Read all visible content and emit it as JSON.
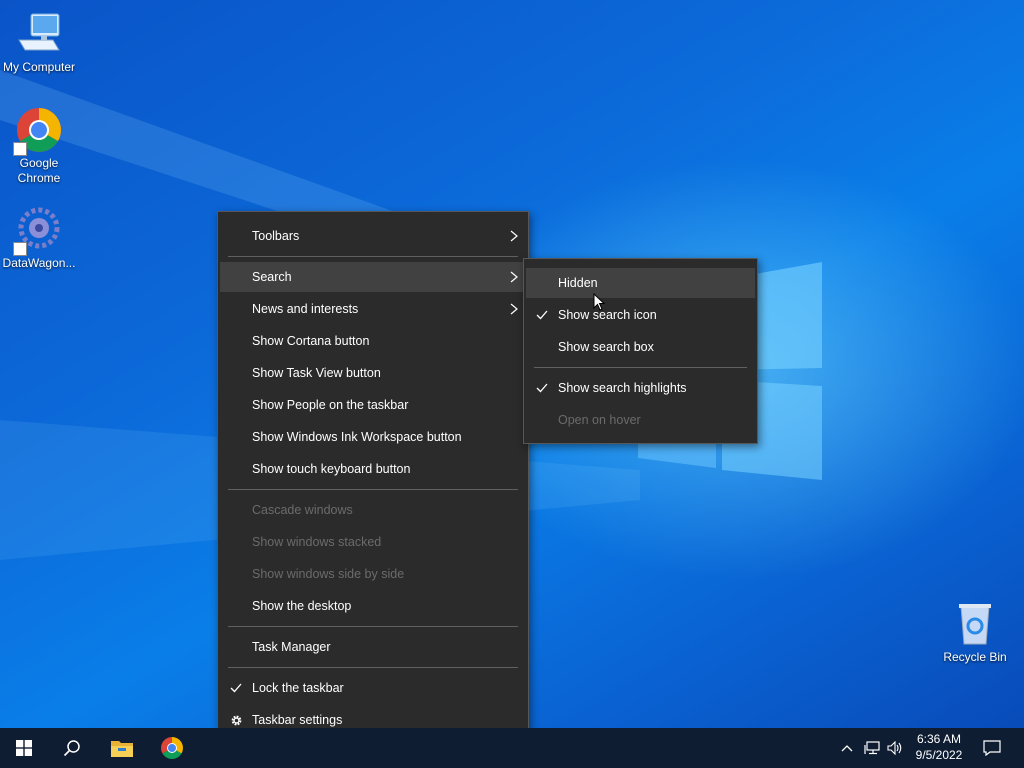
{
  "desktop": {
    "icons": [
      {
        "label": "My Computer",
        "icon": "computer-icon"
      },
      {
        "label": "Google Chrome",
        "icon": "chrome-icon"
      },
      {
        "label": "DataWagon...",
        "icon": "datawagon-icon"
      },
      {
        "label": "Recycle Bin",
        "icon": "recycle-bin-icon"
      }
    ]
  },
  "context_menu": {
    "items": [
      {
        "label": "Toolbars",
        "submenu": true
      },
      {
        "label": "Search",
        "submenu": true,
        "highlighted": true
      },
      {
        "label": "News and interests",
        "submenu": true
      },
      {
        "label": "Show Cortana button"
      },
      {
        "label": "Show Task View button"
      },
      {
        "label": "Show People on the taskbar"
      },
      {
        "label": "Show Windows Ink Workspace button"
      },
      {
        "label": "Show touch keyboard button"
      },
      {
        "label": "Cascade windows",
        "disabled": true
      },
      {
        "label": "Show windows stacked",
        "disabled": true
      },
      {
        "label": "Show windows side by side",
        "disabled": true
      },
      {
        "label": "Show the desktop"
      },
      {
        "label": "Task Manager"
      },
      {
        "label": "Lock the taskbar",
        "checked": true
      },
      {
        "label": "Taskbar settings",
        "icon": "gear-icon"
      }
    ]
  },
  "search_submenu": {
    "items": [
      {
        "label": "Hidden",
        "highlighted": true
      },
      {
        "label": "Show search icon",
        "checked": true
      },
      {
        "label": "Show search box"
      },
      {
        "label": "Show search highlights",
        "checked": true
      },
      {
        "label": "Open on hover",
        "disabled": true
      }
    ]
  },
  "taskbar": {
    "time": "6:36 AM",
    "date": "9/5/2022",
    "pinned": [
      "start-icon",
      "search-icon",
      "file-explorer-icon",
      "chrome-icon"
    ]
  },
  "colors": {
    "menu_bg": "#2b2b2b",
    "menu_hover": "#414141",
    "taskbar_bg": "#0f1d33",
    "desktop_accent": "#0a6ad9"
  }
}
